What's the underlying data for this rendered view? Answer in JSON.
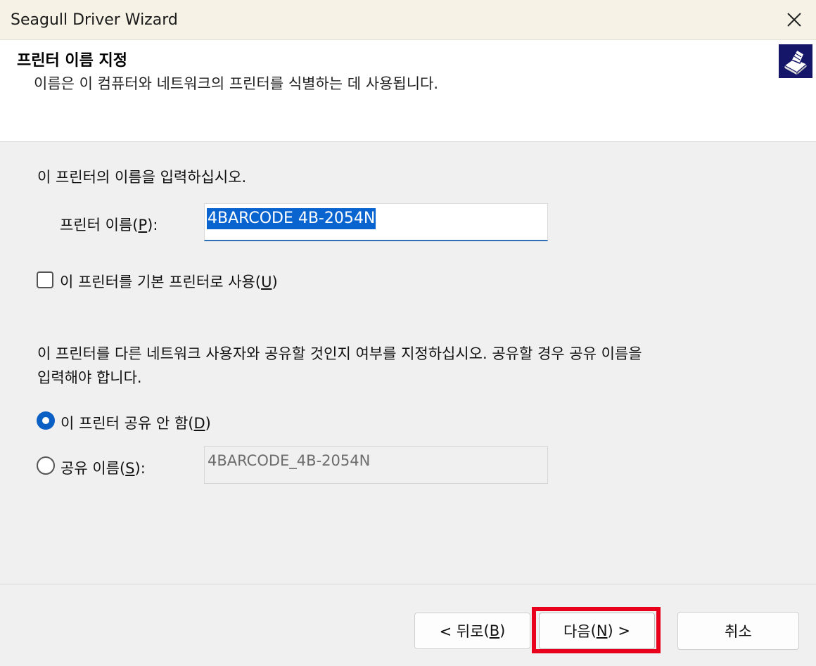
{
  "window": {
    "title": "Seagull Driver Wizard"
  },
  "header": {
    "title": "프린터 이름 지정",
    "subtitle": "이름은 이 컴퓨터와 네트워크의 프린터를 식별하는 데 사용됩니다.",
    "icon": "printer-wizard-icon"
  },
  "body": {
    "name_prompt": "이 프린터의 이름을 입력하십시오.",
    "printer_name_label": "프린터 이름",
    "printer_name_hotkey": "P",
    "printer_name_value": "4BARCODE 4B-2054N",
    "default_label": "이 프린터를 기본 프린터로 사용",
    "default_hotkey": "U",
    "default_checked": false,
    "share_prompt_line1": "이 프린터를 다른 네트워크 사용자와 공유할 것인지 여부를 지정하십시오. 공유할 경우 공유 이름을",
    "share_prompt_line2": "입력해야 합니다.",
    "no_share_label": "이 프린터 공유 안 함",
    "no_share_hotkey": "D",
    "share_name_label": "공유 이름",
    "share_name_hotkey": "S",
    "share_name_value": "4BARCODE_4B-2054N",
    "selected_option": "no_share"
  },
  "footer": {
    "back_prefix": "< 뒤로",
    "back_hotkey": "B",
    "next_prefix": "다음",
    "next_hotkey": "N",
    "next_suffix": " >",
    "cancel_label": "취소"
  },
  "colors": {
    "accent": "#0a5fc4",
    "highlight": "#e8001c",
    "selection": "#0a64d0"
  }
}
